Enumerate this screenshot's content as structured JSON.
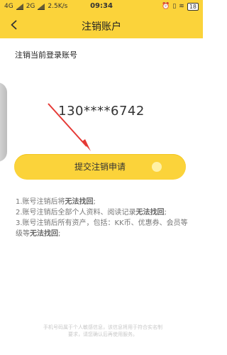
{
  "status_bar": {
    "network1": "4G",
    "network2": "2G",
    "speed": "2.5K/s",
    "time": "09:34",
    "battery": "18"
  },
  "header": {
    "title": "注销账户"
  },
  "main": {
    "subtitle": "注销当前登录账号",
    "account": "130****6742",
    "submit_label": "提交注销申请",
    "notes": [
      {
        "prefix": "1.账号注销后将",
        "bold": "无法找回",
        "suffix": ";"
      },
      {
        "prefix": "2.账号注销后全部个人资料、阅读记录",
        "bold": "无法找回",
        "suffix": ";"
      },
      {
        "prefix": "3.账号注销后所有资产，包括：KK币、优惠券、会员等级等",
        "bold": "无法找回",
        "suffix": ";"
      }
    ],
    "footer": "手机号码属于个人敏感信息，该信息将用于符合实名制要求，请您确认后再使用服务。"
  },
  "colors": {
    "accent": "#fbd33a",
    "arrow": "#e53935"
  }
}
